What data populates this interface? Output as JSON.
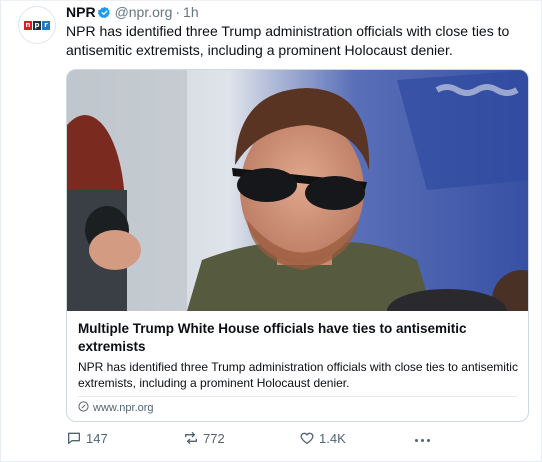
{
  "author": {
    "name": "NPR",
    "handle": "@npr.org",
    "separator": "·",
    "time": "1h",
    "avatar_letters": [
      "n",
      "p",
      "r"
    ],
    "avatar_colors": [
      "#d62021",
      "#22303c",
      "#237bbd"
    ],
    "verified_color": "#1d9bf0"
  },
  "post": {
    "text": "NPR has identified three Trump administration officials with close ties to antisemitic extremists, including a prominent Holocaust denier."
  },
  "card": {
    "image_icon": "photo-of-man-in-sunglasses",
    "title": "Multiple Trump White House officials have ties to antisemitic extremists",
    "description": "NPR has identified three Trump administration officials with close ties to antisemitic extremists, including a prominent Holocaust denier.",
    "domain": "www.npr.org",
    "domain_icon": "link-icon"
  },
  "actions": {
    "replies": "147",
    "reposts": "772",
    "likes": "1.4K",
    "reply_icon": "comment-icon",
    "repost_icon": "repost-icon",
    "like_icon": "heart-icon",
    "more_icon": "more-dots-icon"
  },
  "colors": {
    "muted_text": "#66757f",
    "action_text": "#536471",
    "border": "#cfd9de"
  }
}
